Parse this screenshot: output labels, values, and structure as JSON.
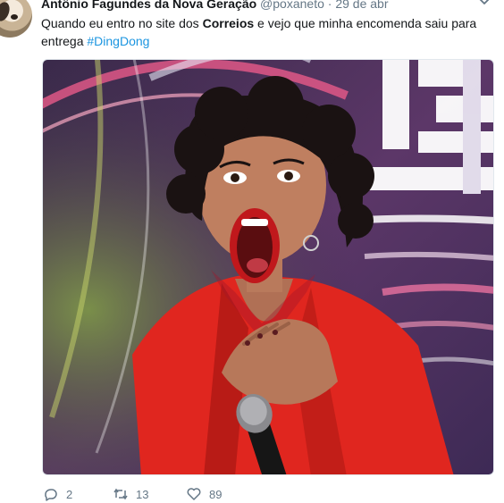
{
  "tweet": {
    "author_name": "Antônio Fagundes da Nova Geração",
    "handle": "@poxaneto",
    "separator": "·",
    "date": "29 de abr",
    "text_part1": "Quando eu entro no site dos ",
    "text_bold": "Correios",
    "text_part2": " e vejo que minha encomenda saiu para entrega ",
    "hashtag": "#DingDong"
  },
  "actions": {
    "replies": "2",
    "retweets": "13",
    "likes": "89"
  },
  "icons": {
    "menu": "chevron-down-icon",
    "reply": "reply-icon",
    "retweet": "retweet-icon",
    "like": "heart-icon"
  },
  "colors": {
    "text": "#14171a",
    "secondary": "#657786",
    "link": "#1b95e0"
  }
}
